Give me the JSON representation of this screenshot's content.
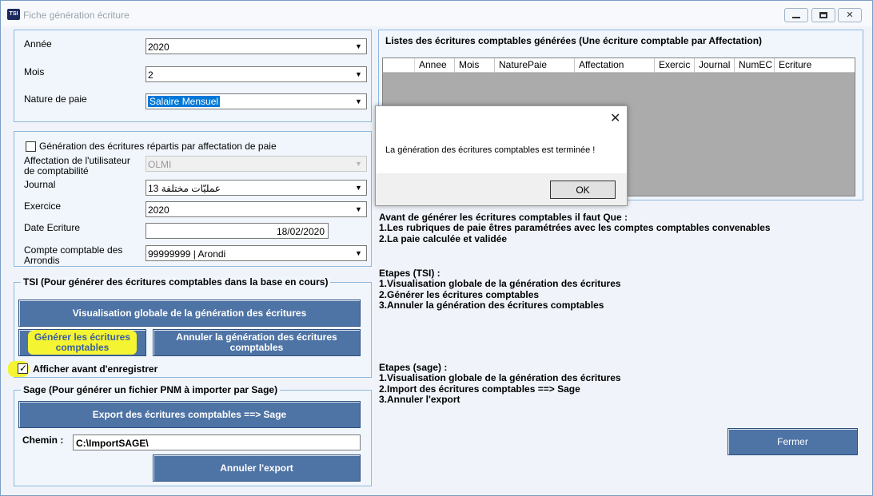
{
  "window": {
    "title": "Fiche génération écriture",
    "app_badge": "TSI"
  },
  "period": {
    "annee_label": "Année",
    "annee_value": "2020",
    "mois_label": "Mois",
    "mois_value": "2",
    "nature_label": "Nature de paie",
    "nature_value": "Salaire Mensuel"
  },
  "params": {
    "gen_checkbox_label": "Génération des écritures répartis par affectation de paie",
    "affectation_label_1": "Affectation de l'utilisateur",
    "affectation_label_2": "de comptabilité",
    "affectation_value": "OLMI",
    "journal_label": "Journal",
    "journal_value": "13  عمليّات مختلفة",
    "exercice_label": "Exercice",
    "exercice_value": "2020",
    "date_label": "Date Ecriture",
    "date_value": "18/02/2020",
    "compte_label_1": "Compte comptable des",
    "compte_label_2": "Arrondis",
    "compte_value": "99999999 | Arondi"
  },
  "tsi": {
    "legend": "TSI (Pour générer des écritures comptables dans la base en cours)",
    "btn_visualisation": "Visualisation globale de la génération des écritures",
    "btn_generer_1": "Générer les écritures",
    "btn_generer_2": "comptables",
    "btn_annuler_1": "Annuler la génération des écritures",
    "btn_annuler_2": "comptables",
    "afficher_label": "Afficher avant d'enregistrer"
  },
  "sage": {
    "legend": "Sage (Pour générer un fichier PNM à importer par Sage)",
    "btn_export": "Export des écritures comptables ==> Sage",
    "chemin_label": "Chemin :",
    "chemin_value": "C:\\ImportSAGE\\",
    "btn_annuler_export": "Annuler l'export"
  },
  "liste": {
    "title": "Listes des écritures comptables générées (Une écriture comptable par Affectation)",
    "columns": [
      "Annee",
      "Mois",
      "NaturePaie",
      "Affectation",
      "Exercic",
      "Journal",
      "NumEC",
      "Ecriture"
    ]
  },
  "info": {
    "lines": [
      "Avant de générer les écritures comptables il faut Que :",
      "1.Les rubriques de paie êtres paramétrées avec les comptes comptables convenables",
      "2.La paie calculée et validée"
    ],
    "tsi_lines": [
      "Etapes (TSI) :",
      "1.Visualisation globale de la génération des écritures",
      "2.Générer les écritures comptables",
      "3.Annuler la génération des écritures comptables"
    ],
    "sage_lines": [
      "Etapes (sage) :",
      "1.Visualisation globale de la génération des écritures",
      "2.Import des écritures comptables ==> Sage",
      "3.Annuler l'export"
    ]
  },
  "btn_fermer": "Fermer",
  "dialog": {
    "message": "La génération des écritures comptables est terminée !",
    "ok": "OK"
  }
}
